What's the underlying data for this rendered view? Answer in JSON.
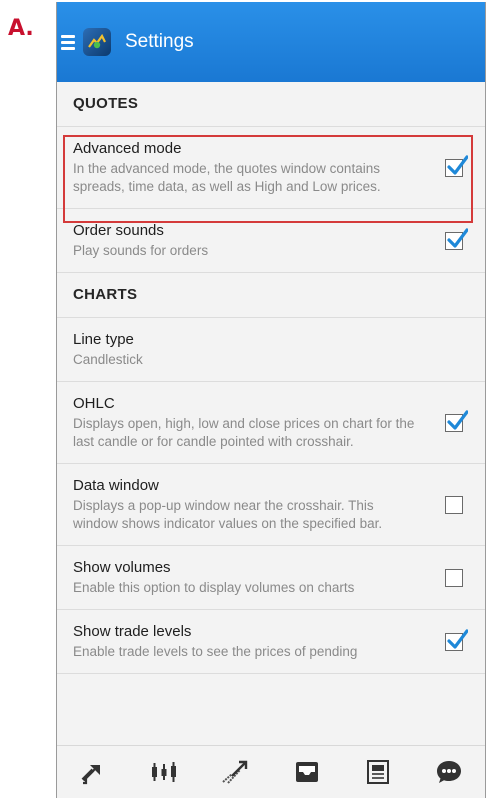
{
  "figure_label": "A.",
  "app": {
    "title": "Settings"
  },
  "sections": [
    {
      "heading": "QUOTES"
    },
    {
      "heading": "CHARTS"
    }
  ],
  "quotes_items": [
    {
      "title": "Advanced mode",
      "subtitle": "In the advanced mode, the quotes window contains spreads, time data, as well as High and Low prices.",
      "checked": true
    },
    {
      "title": "Order sounds",
      "subtitle": "Play sounds for orders",
      "checked": true
    }
  ],
  "charts_items": [
    {
      "title": "Line type",
      "subtitle": "Candlestick",
      "checked": null
    },
    {
      "title": "OHLC",
      "subtitle": "Displays open, high, low and close prices on chart for the last candle or for candle pointed with crosshair.",
      "checked": true
    },
    {
      "title": "Data window",
      "subtitle": "Displays a pop-up window near the crosshair. This window shows indicator values on the specified bar.",
      "checked": false
    },
    {
      "title": "Show volumes",
      "subtitle": "Enable this option to display volumes on charts",
      "checked": false
    },
    {
      "title": "Show trade levels",
      "subtitle": "Enable trade levels to see the prices of pending",
      "checked": true
    }
  ],
  "bottom_tabs": [
    "quotes-icon",
    "chart-icon",
    "trade-icon",
    "history-icon",
    "news-icon",
    "chat-icon"
  ],
  "colors": {
    "accent": "#1e82dc",
    "highlight": "#d43a3a",
    "check": "#1e88d8"
  }
}
